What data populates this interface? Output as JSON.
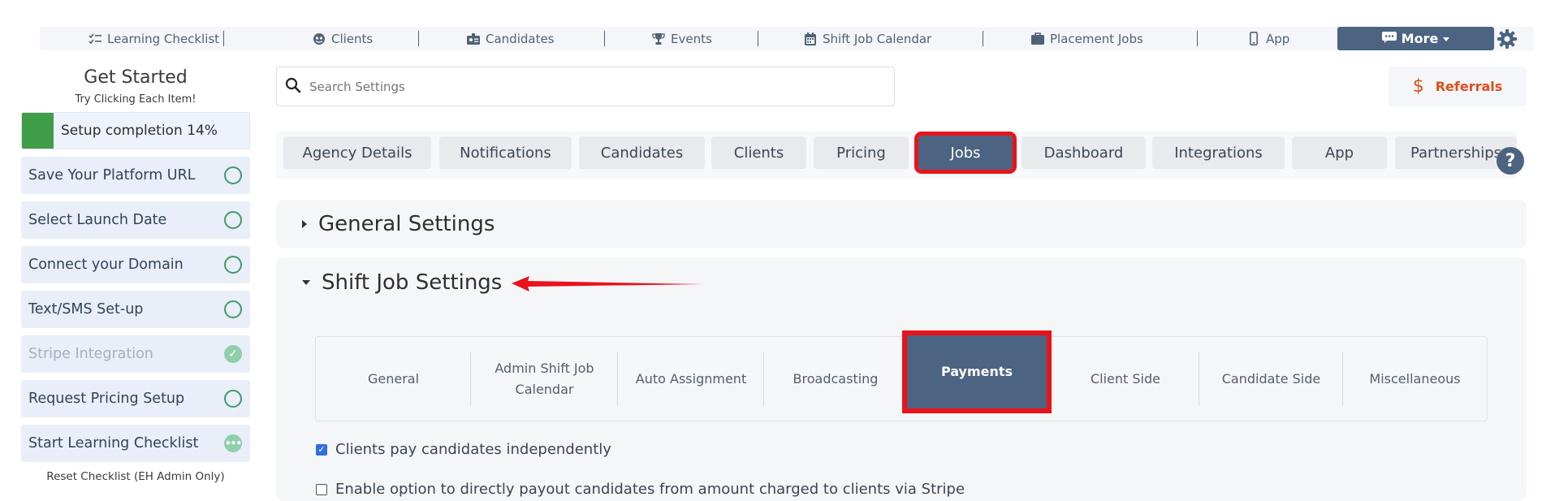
{
  "topnav": {
    "items": [
      {
        "label": "Learning Checklist",
        "icon": "checklist-icon"
      },
      {
        "label": "Clients",
        "icon": "globe-icon"
      },
      {
        "label": "Candidates",
        "icon": "id-card-icon"
      },
      {
        "label": "Events",
        "icon": "trophy-icon"
      },
      {
        "label": "Shift Job Calendar",
        "icon": "calendar-icon"
      },
      {
        "label": "Placement Jobs",
        "icon": "briefcase-icon"
      },
      {
        "label": "App",
        "icon": "phone-icon"
      }
    ],
    "more_label": "More",
    "settings_icon": "gear-icon"
  },
  "sidebar": {
    "title": "Get Started",
    "subtitle": "Try Clicking Each Item!",
    "progress_label": "Setup completion 14%",
    "progress_fraction": 0.14,
    "items": [
      {
        "label": "Save Your Platform URL",
        "status": "open"
      },
      {
        "label": "Select Launch Date",
        "status": "open"
      },
      {
        "label": "Connect your Domain",
        "status": "open"
      },
      {
        "label": "Text/SMS Set-up",
        "status": "open"
      },
      {
        "label": "Stripe Integration",
        "status": "done"
      },
      {
        "label": "Request Pricing Setup",
        "status": "open"
      },
      {
        "label": "Start Learning Checklist",
        "status": "in-progress"
      }
    ],
    "reset_label": "Reset Checklist (EH Admin Only)"
  },
  "search": {
    "placeholder": "Search Settings"
  },
  "referrals": {
    "label": "Referrals"
  },
  "tabs": {
    "items": [
      "Agency Details",
      "Notifications",
      "Candidates",
      "Clients",
      "Pricing",
      "Jobs",
      "Dashboard",
      "Integrations",
      "App",
      "Partnerships"
    ],
    "active": "Jobs"
  },
  "sections": {
    "general": "General Settings",
    "shift": "Shift Job Settings"
  },
  "subtabs": {
    "items": [
      "General",
      "Admin Shift Job Calendar",
      "Auto Assignment",
      "Broadcasting",
      "Payments",
      "Client Side",
      "Candidate Side",
      "Miscellaneous"
    ],
    "active": "Payments"
  },
  "options": [
    {
      "label": "Clients pay candidates independently",
      "checked": true
    },
    {
      "label": "Enable option to directly payout candidates from amount charged to clients via Stripe",
      "checked": false
    }
  ],
  "colors": {
    "accent": "#4c6382",
    "highlight": "#e8131b",
    "referral": "#e04e1d",
    "progress": "#3f9c47"
  }
}
